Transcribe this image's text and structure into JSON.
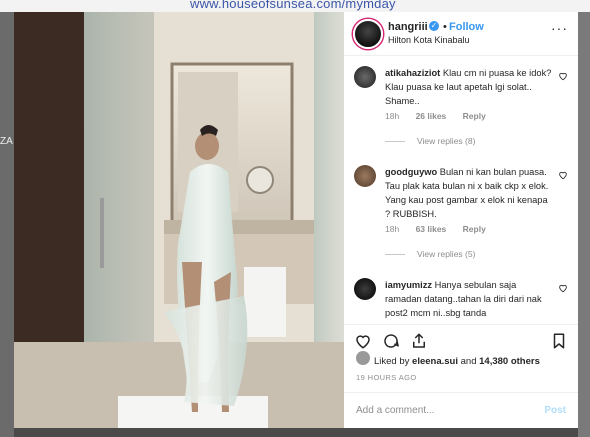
{
  "background": {
    "url_text": "www.houseofsunsea.com/mymday",
    "side_text": "ZA"
  },
  "post": {
    "username": "hangriii",
    "verified_mark": "✓",
    "dot": "•",
    "follow_label": "Follow",
    "location": "Hilton Kota Kinabalu",
    "more_label": "···"
  },
  "comments": [
    {
      "username": "atikahaziziot",
      "text": "Klau cm ni puasa ke idok? Klau puasa ke laut apetah lgi solat.. Shame..",
      "time": "18h",
      "likes": "26 likes",
      "reply": "Reply",
      "view_replies": "View replies (8)"
    },
    {
      "username": "goodguywo",
      "text": "Bulan ni kan bulan puasa. Tau plak kata bulan ni x baik ckp x elok. Yang kau post gambar x elok ni kenapa ? RUBBISH.",
      "time": "18h",
      "likes": "63 likes",
      "reply": "Reply",
      "view_replies": "View replies (5)"
    },
    {
      "username": "iamyumizz",
      "text": "Hanya sebulan saja ramadan datang..tahan la diri dari nak post2 mcm ni..sbg tanda"
    }
  ],
  "likes": {
    "prefix": "Liked by",
    "user": "eleena.sui",
    "middle": "and",
    "count": "14,380 others"
  },
  "time_ago": "19 HOURS AGO",
  "add_comment": {
    "placeholder": "Add a comment...",
    "post_label": "Post"
  },
  "colors": {
    "accent": "#3897f0",
    "text": "#262626",
    "muted": "#8e8e8e"
  }
}
